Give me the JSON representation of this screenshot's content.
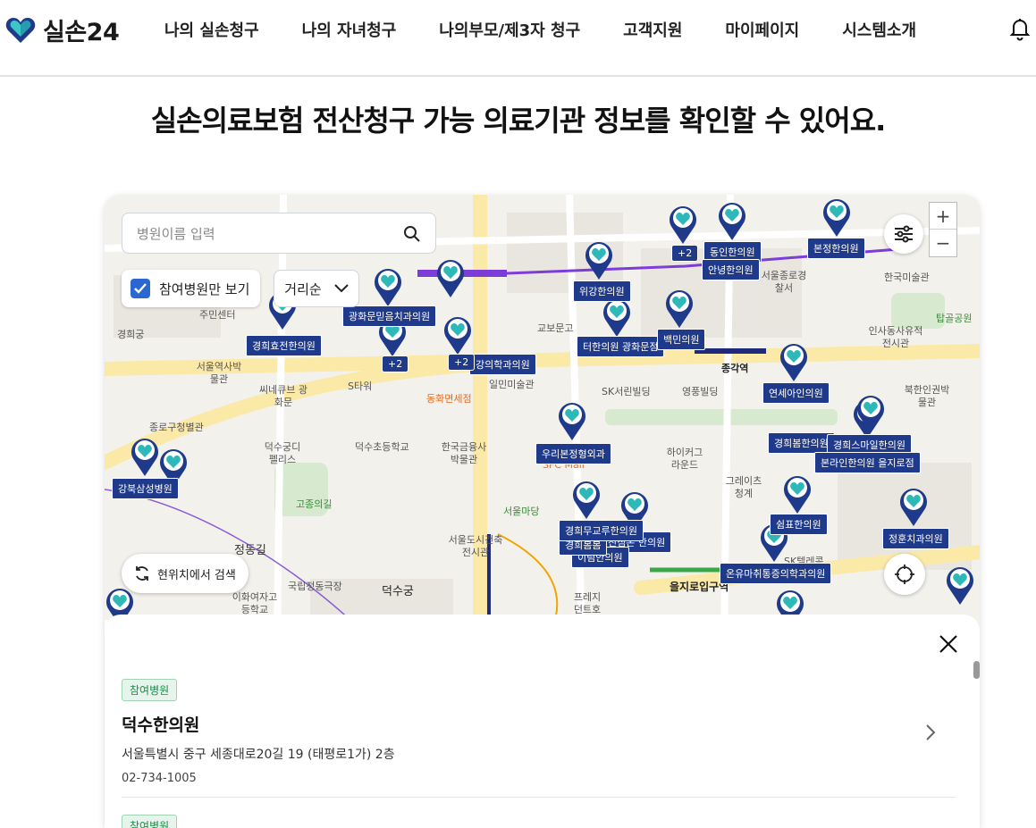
{
  "header": {
    "logo_text": "실손24",
    "nav": [
      "나의 실손청구",
      "나의 자녀청구",
      "나의부모/제3자 청구",
      "고객지원",
      "마이페이지",
      "시스템소개"
    ],
    "accent_color": "#1f3a8a"
  },
  "headline": "실손의료보험 전산청구 가능 의료기관 정보를 확인할 수 있어요.",
  "map": {
    "search_placeholder": "병원이름 입력",
    "participate_only_label": "참여병원만 보기",
    "participate_only_checked": true,
    "sort_label": "거리순",
    "current_location_search": "현위치에서 검색",
    "zoom_in": "+",
    "zoom_out": "−",
    "hospital_labels": [
      "본정한의원",
      "동인한의원",
      "안녕한의원",
      "위강한의원",
      "터한의원 광화문점",
      "백민의원",
      "연세아인의원",
      "경희봄한의원",
      "경희스마일한의원",
      "본라인한의원 을지로점",
      "우리본정형외과",
      "경희효전한의원",
      "광화문믿음치과의원",
      "강북삼성병원",
      "쉼표한의원",
      "정훈치과의원",
      "진심온 한의원",
      "이림안의원",
      "경희봄봄",
      "온유마취통증의학과의원",
      "강의학과의원",
      "경희무교루한의원"
    ],
    "clusters": [
      "+2",
      "+2",
      "+2"
    ],
    "places": [
      "종각역",
      "을지로입구역",
      "덕수궁",
      "정동길",
      "서울도시건축전시관",
      "교보문고",
      "SK서린빌딩",
      "영풍빌딩",
      "북한인권박물관",
      "서울역사박물관",
      "씨네큐브 광화문",
      "국립정동극장",
      "이화여자고등학교",
      "덕수초등학교",
      "한국금융사박물관",
      "서울마당",
      "경희궁",
      "주민센터",
      "고종의길",
      "프레지던트호텔",
      "인사동사유적전시관",
      "탑골공원",
      "한국미술관",
      "서울종로경찰서",
      "동화면세점",
      "SFC Mall",
      "하이커그라운드",
      "그레이츠청계",
      "SK텔레콤",
      "종로구청별관",
      "덕수궁디펠리스",
      "일민미술관",
      "S타워",
      "한국금융사박물관"
    ]
  },
  "panel": {
    "items": [
      {
        "tag": "참여병원",
        "name": "덕수한의원",
        "address": "서울특별시 중구 세종대로20길 19 (태평로1가) 2층",
        "phone": "02-734-1005"
      },
      {
        "tag": "참여병원"
      }
    ]
  }
}
